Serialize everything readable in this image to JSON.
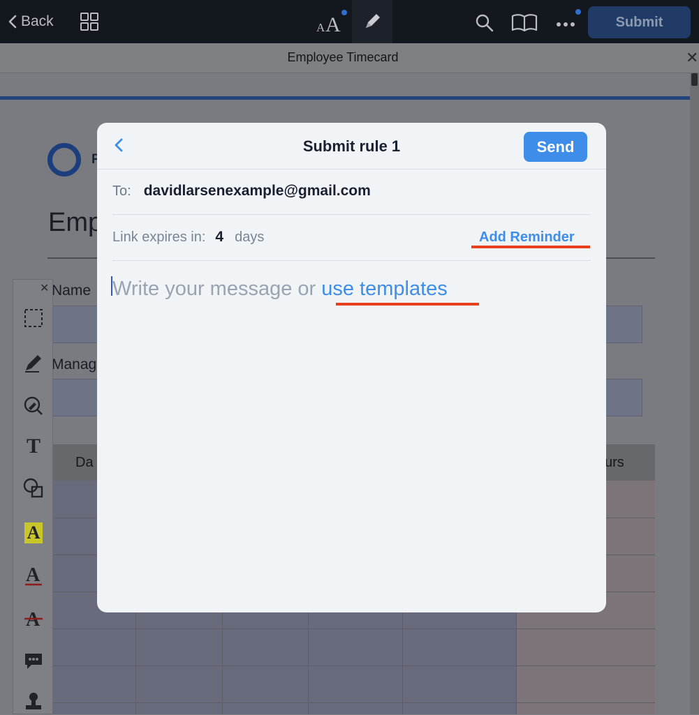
{
  "topbar": {
    "back_label": "Back",
    "submit_label": "Submit",
    "icons": [
      "grid-icon",
      "text-size-icon",
      "pen-icon",
      "search-icon",
      "book-icon",
      "more-icon"
    ],
    "accent_color": "#2f6fd1"
  },
  "document": {
    "title": "Employee Timecard",
    "logo_letter": "F",
    "heading": "Emp",
    "field_labels": [
      "Name",
      "Manag"
    ],
    "table_headers": [
      "Da",
      "urs"
    ]
  },
  "toolbox": {
    "tools": [
      "selection-icon",
      "pen-icon",
      "eraser-icon",
      "text-tool-icon",
      "shapes-icon",
      "highlight-text-icon",
      "underline-text-icon",
      "strikethrough-text-icon",
      "comment-icon",
      "stamp-icon"
    ]
  },
  "modal": {
    "title": "Submit rule 1",
    "send_label": "Send",
    "to_label": "To:",
    "recipient": "davidlarsenexample@gmail.com",
    "expires_label": "Link expires in:",
    "expires_value": "4",
    "expires_unit": "days",
    "reminder_label": "Add Reminder",
    "placeholder_prefix": "Write your message or ",
    "templates_label": "use templates",
    "accent_color": "#3d8de9",
    "highlight_color": "#e8401f"
  }
}
